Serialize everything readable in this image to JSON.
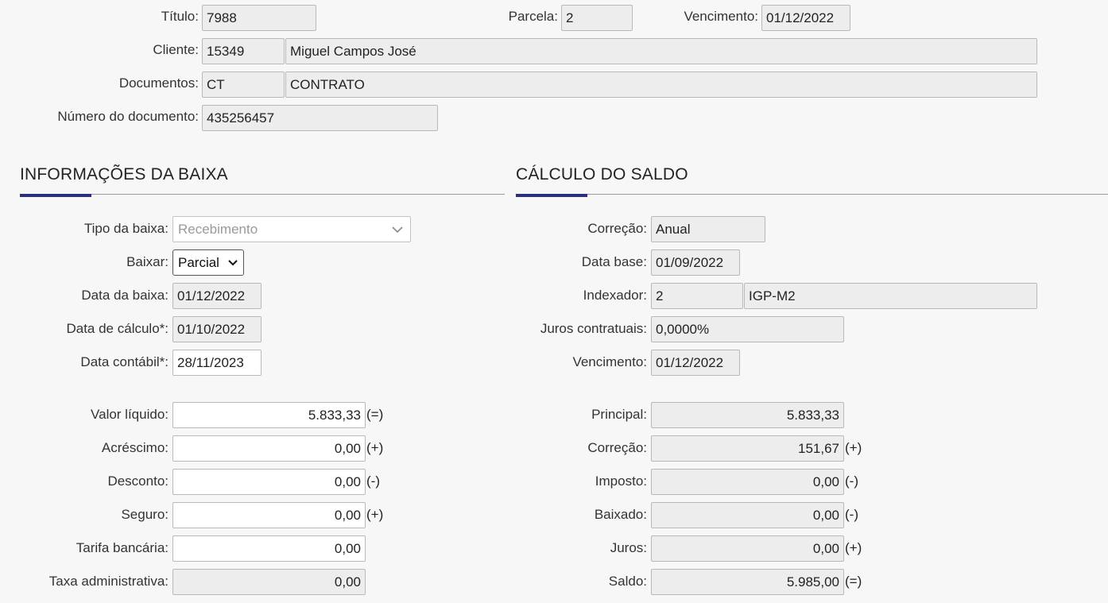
{
  "header": {
    "titulo": {
      "label": "Título:",
      "value": "7988"
    },
    "parcela": {
      "label": "Parcela:",
      "value": "2"
    },
    "vencimento": {
      "label": "Vencimento:",
      "value": "01/12/2022"
    },
    "cliente": {
      "label": "Cliente:",
      "code": "15349",
      "name": "Miguel Campos José"
    },
    "documentos": {
      "label": "Documentos:",
      "code": "CT",
      "name": "CONTRATO"
    },
    "numero_documento": {
      "label": "Número do documento:",
      "value": "435256457"
    }
  },
  "baixa": {
    "title": "INFORMAÇÕES DA BAIXA",
    "tipo": {
      "label": "Tipo da baixa:",
      "value": "Recebimento"
    },
    "baixar": {
      "label": "Baixar:",
      "value": "Parcial"
    },
    "data_baixa": {
      "label": "Data da baixa:",
      "value": "01/12/2022"
    },
    "data_calculo": {
      "label": "Data de cálculo*:",
      "value": "01/10/2022"
    },
    "data_contabil": {
      "label": "Data contábil*:",
      "value": "28/11/2023"
    },
    "valores": [
      {
        "label": "Valor líquido:",
        "value": "5.833,33",
        "sign": "(=)"
      },
      {
        "label": "Acréscimo:",
        "value": "0,00",
        "sign": "(+)"
      },
      {
        "label": "Desconto:",
        "value": "0,00",
        "sign": "(-)"
      },
      {
        "label": "Seguro:",
        "value": "0,00",
        "sign": "(+)"
      },
      {
        "label": "Tarifa bancária:",
        "value": "0,00",
        "sign": ""
      },
      {
        "label": "Taxa administrativa:",
        "value": "0,00",
        "sign": ""
      }
    ]
  },
  "saldo": {
    "title": "CÁLCULO DO SALDO",
    "correcao": {
      "label": "Correção:",
      "value": "Anual"
    },
    "data_base": {
      "label": "Data base:",
      "value": "01/09/2022"
    },
    "indexador": {
      "label": "Indexador:",
      "code": "2",
      "name": "IGP-M2"
    },
    "juros_contratuais": {
      "label": "Juros contratuais:",
      "value": "0,0000%"
    },
    "vencimento": {
      "label": "Vencimento:",
      "value": "01/12/2022"
    },
    "valores": [
      {
        "label": "Principal:",
        "value": "5.833,33",
        "sign": ""
      },
      {
        "label": "Correção:",
        "value": "151,67",
        "sign": "(+)"
      },
      {
        "label": "Imposto:",
        "value": "0,00",
        "sign": "(-)"
      },
      {
        "label": "Baixado:",
        "value": "0,00",
        "sign": "(-)"
      },
      {
        "label": "Juros:",
        "value": "0,00",
        "sign": "(+)"
      },
      {
        "label": "Saldo:",
        "value": "5.985,00",
        "sign": "(=)"
      }
    ]
  },
  "colors": {
    "accent": "#2b2f7e",
    "field_bg": "#ededed",
    "page_bg": "#f7f7f7"
  }
}
